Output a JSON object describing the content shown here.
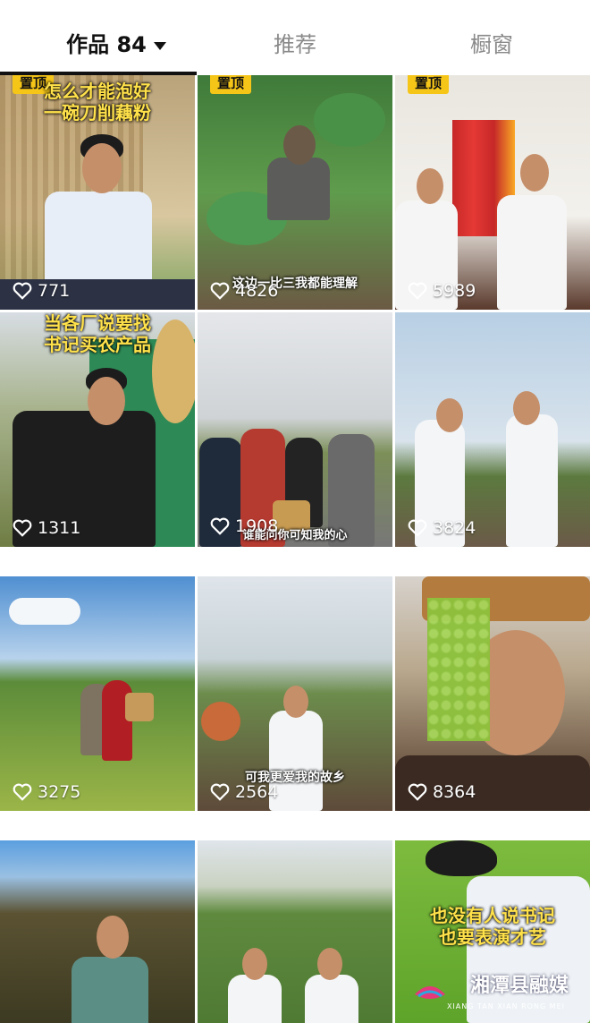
{
  "tabs": [
    {
      "label": "作品 84"
    },
    {
      "label": "推荐"
    },
    {
      "label": "橱窗"
    }
  ],
  "pinned_label": "置顶",
  "videos": [
    {
      "likes": "771",
      "caption": "怎么才能泡好\n一碗刀削藕粉",
      "pinned": true
    },
    {
      "likes": "4826",
      "caption": "",
      "subtitle": "这边一比三我都能理解",
      "pinned": true
    },
    {
      "likes": "5989",
      "caption": "",
      "pinned": true
    },
    {
      "likes": "1311",
      "caption": "当各厂说要找\n书记买农产品"
    },
    {
      "likes": "1908",
      "subtitle": "谁能问你可知我的心"
    },
    {
      "likes": "3824"
    },
    {
      "likes": "3275"
    },
    {
      "likes": "2564",
      "subtitle": "可我更爱我的故乡"
    },
    {
      "likes": "8364"
    },
    {
      "likes": "",
      "caption": ""
    },
    {
      "likes": ""
    },
    {
      "likes": "",
      "caption": "也没有人说书记\n也要表演才艺"
    }
  ],
  "watermark": {
    "text": "湘潭县融媒",
    "sub": "XIANG TAN XIAN RONG MEI"
  },
  "colors": {
    "pin": "#f5c518",
    "active_tab": "#111111",
    "inactive_tab": "#8a8a8a"
  }
}
